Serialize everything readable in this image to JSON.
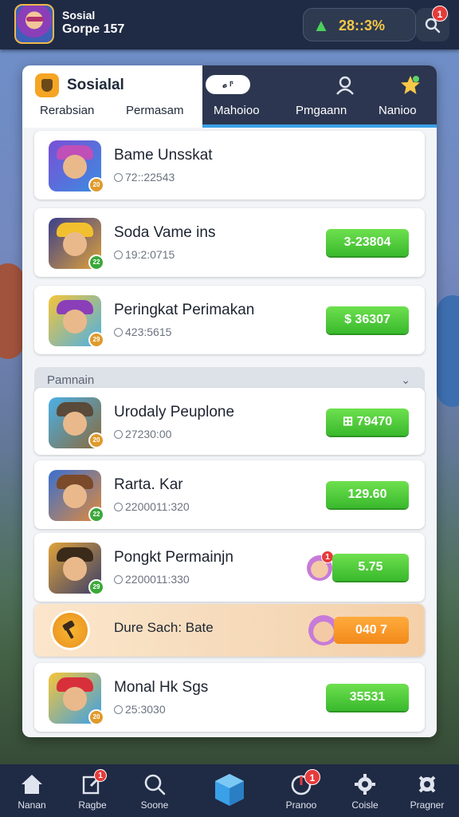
{
  "header": {
    "profile_name": "Sosial",
    "profile_sub": "Gorpe 157",
    "currency_value": "28::3%",
    "notification_count": "1"
  },
  "panel": {
    "title": "Sosialal",
    "pill_text": "𝓸 ⸁",
    "tabs": [
      {
        "label": "Rerabsian"
      },
      {
        "label": "Permasam"
      },
      {
        "label": "Mahoioo"
      },
      {
        "label": "Pmgaann"
      },
      {
        "label": "Nanioo"
      }
    ]
  },
  "games": [
    {
      "title": "Bame Unsskat",
      "time": "72::22543",
      "level": "20",
      "button": ""
    },
    {
      "title": "Soda Vame ins",
      "time": "19:2:0715",
      "level": "22",
      "button": "3-23804"
    },
    {
      "title": "Peringkat Perimakan",
      "time": "423:5615",
      "level": "29",
      "button": "$ 36307"
    }
  ],
  "section": {
    "label": "Pamnain"
  },
  "players": [
    {
      "title": "Urodaly Peuplone",
      "time": "27230:00",
      "level": "20",
      "button": "⊞ 79470"
    },
    {
      "title": "Rarta. Kar",
      "time": "2200011:320",
      "level": "22",
      "button": "129.60"
    },
    {
      "title": "Pongkt Permainjn",
      "time": "2200011:330",
      "level": "29",
      "button": "5.75",
      "badge": "1"
    }
  ],
  "promo": {
    "title": "Dure Sach: Bate",
    "button": "040 7"
  },
  "last_game": {
    "title": "Monal Hk Sgs",
    "time": "25:3030",
    "level": "20",
    "button": "35531"
  },
  "nav": [
    {
      "label": "Nanan"
    },
    {
      "label": "Ragbe",
      "badge": "1"
    },
    {
      "label": "Soone"
    },
    {
      "label": ""
    },
    {
      "label": "Pranoo",
      "badge": "1"
    },
    {
      "label": "Coisle"
    },
    {
      "label": "Pragner"
    }
  ],
  "colors": {
    "accent": "#3aa0e8",
    "green": "#39b92c",
    "orange": "#f28a1a",
    "dark": "#1f2a44"
  }
}
